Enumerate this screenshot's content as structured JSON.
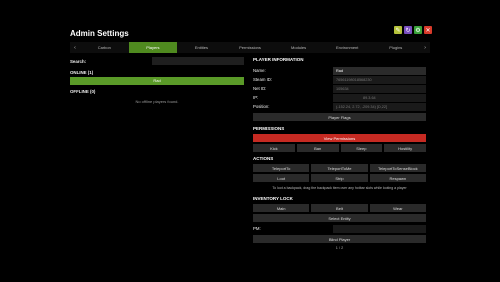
{
  "window": {
    "title": "Admin Settings",
    "controls": [
      {
        "name": "minimize",
        "color": "#b5c23a",
        "glyph": "✎"
      },
      {
        "name": "refresh",
        "color": "#7a4fc0",
        "glyph": "↻"
      },
      {
        "name": "settings",
        "color": "#3aa33a",
        "glyph": "⚙"
      },
      {
        "name": "close",
        "color": "#d83a2a",
        "glyph": "✕"
      }
    ]
  },
  "tabs": {
    "prev": "‹",
    "next": "›",
    "items": [
      "Carbon",
      "Players",
      "Entities",
      "Permissions",
      "Modules",
      "Environment",
      "Plugins"
    ],
    "active": "Players"
  },
  "left": {
    "search_label": "Search:",
    "online_header": "ONLINE (1)",
    "online_players": [
      "Rad"
    ],
    "offline_header": "OFFLINE (0)",
    "offline_empty": "No offline players found."
  },
  "player_info": {
    "header": "PLAYER INFORMATION",
    "fields": [
      {
        "label": "Name:",
        "value": "Rad",
        "highlight": true
      },
      {
        "label": "Steam ID:",
        "value": "76561198018568230"
      },
      {
        "label": "Net ID:",
        "value": "105634"
      },
      {
        "label": "IP:",
        "value": "89.3.64"
      },
      {
        "label": "Position:",
        "value": "(-152.24, 2.72, -209.34) [D,22]"
      }
    ],
    "flags_button": "Player Flags"
  },
  "permissions": {
    "header": "PERMISSIONS",
    "view_button": "View Permissions",
    "actions": [
      "Kick",
      "Ban",
      "Sleep",
      "Hostility"
    ]
  },
  "actions": {
    "header": "ACTIONS",
    "row1": [
      "TeleportTo",
      "TeleportToMe",
      "TeleportToSenseBlock"
    ],
    "row2": [
      "Loot",
      "Strip",
      "Respawn"
    ],
    "hint": "To loot a backpack, drag the backpack item over any hotbar slots while looting a player"
  },
  "inventory": {
    "header": "INVENTORY LOCK",
    "slots": [
      "Main",
      "Belt",
      "Wear"
    ],
    "select_entity": "Select Entity",
    "pm_label": "PM:",
    "blind_button": "Blind Player",
    "page": "1 / 2"
  }
}
